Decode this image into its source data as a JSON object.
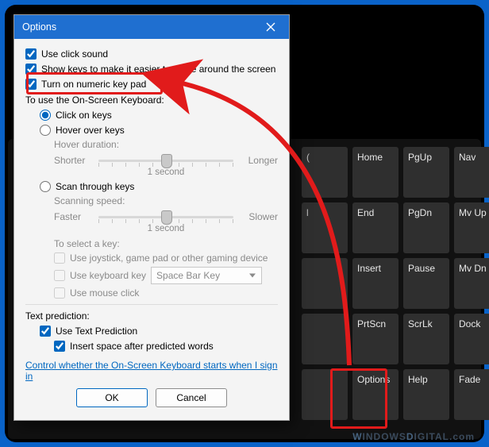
{
  "dialog": {
    "title": "Options",
    "checkboxes": {
      "use_click_sound": "Use click sound",
      "show_keys": "Show keys to make it easier to move around the screen",
      "turn_on_numpad": "Turn on numeric key pad"
    },
    "use_osk_label": "To use the On-Screen Keyboard:",
    "radios": {
      "click_on_keys": "Click on keys",
      "hover_over_keys": "Hover over keys",
      "scan_through_keys": "Scan through keys"
    },
    "hover": {
      "label": "Hover duration:",
      "left": "Shorter",
      "right": "Longer",
      "caption": "1 second"
    },
    "scan": {
      "label": "Scanning speed:",
      "left": "Faster",
      "right": "Slower",
      "caption": "1 second",
      "select_key_label": "To select a key:",
      "use_joystick": "Use joystick, game pad or other gaming device",
      "use_keyboard_key": "Use keyboard key",
      "keyboard_key_value": "Space Bar Key",
      "use_mouse_click": "Use mouse click"
    },
    "text_prediction": {
      "header": "Text prediction:",
      "use_text_prediction": "Use Text Prediction",
      "insert_space": "Insert space after predicted words"
    },
    "link": "Control whether the On-Screen Keyboard starts when I sign in",
    "buttons": {
      "ok": "OK",
      "cancel": "Cancel"
    }
  },
  "osk_keys": {
    "r1": [
      "(",
      "Home",
      "PgUp",
      "Nav"
    ],
    "r2": [
      "l",
      "End",
      "PgDn",
      "Mv Up"
    ],
    "r3": [
      "",
      "Insert",
      "Pause",
      "Mv Dn"
    ],
    "r4": [
      "",
      "PrtScn",
      "ScrLk",
      "Dock"
    ],
    "r5": [
      "",
      "Options",
      "Help",
      "Fade"
    ]
  },
  "watermark_a": "W",
  "watermark_b": "INDOWS",
  "watermark_c": "D",
  "watermark_d": "IGITAL",
  "watermark_e": ".com"
}
